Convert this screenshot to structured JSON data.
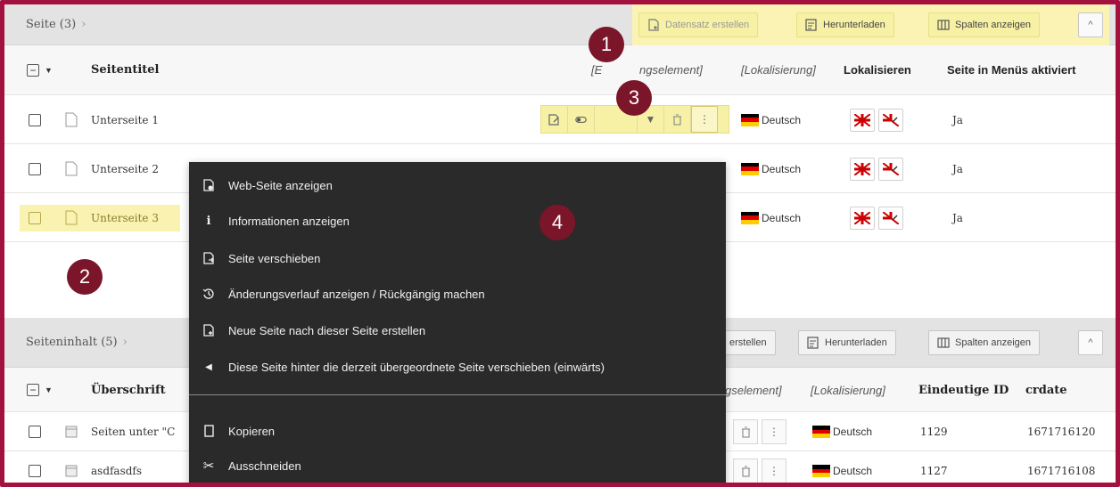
{
  "panel1": {
    "title": "Seite (3)",
    "chevron": "›",
    "buttons": {
      "create": "Datensatz erstellen",
      "download": "Herunterladen",
      "columns": "Spalten anzeigen"
    },
    "collapse": "^",
    "headers": {
      "title": "Seitentitel",
      "element": "[Bearbeitungselement]",
      "element_visible": "[E",
      "element_visible_2": "ngselement]",
      "localization": "[Lokalisierung]",
      "localize": "Lokalisieren",
      "menu_active": "Seite in Menüs aktiviert"
    },
    "rows": [
      {
        "title": "Unterseite 1",
        "language": "Deutsch",
        "menu": "Ja"
      },
      {
        "title": "Unterseite 2",
        "language": "Deutsch",
        "menu": "Ja"
      },
      {
        "title": "Unterseite 3",
        "language": "Deutsch",
        "menu": "Ja"
      }
    ]
  },
  "panel2": {
    "title": "Seiteninhalt (5)",
    "chevron": "›",
    "buttons": {
      "create_partial": "erstellen",
      "download": "Herunterladen",
      "columns": "Spalten anzeigen"
    },
    "collapse": "^",
    "headers": {
      "title": "Überschrift",
      "element_partial": "gselement]",
      "localization": "[Lokalisierung]",
      "uid": "Eindeutige ID",
      "crdate": "crdate"
    },
    "rows": [
      {
        "title": "Seiten unter \"C",
        "language": "Deutsch",
        "uid": "1129",
        "crdate": "1671716120"
      },
      {
        "title": "asdfasdfs",
        "language": "Deutsch",
        "uid": "1127",
        "crdate": "1671716108"
      }
    ]
  },
  "context_menu": {
    "items": [
      {
        "label": "Web-Seite anzeigen",
        "icon": "view-page-icon"
      },
      {
        "label": "Informationen anzeigen",
        "icon": "info-icon"
      },
      {
        "label": "Seite verschieben",
        "icon": "move-page-icon"
      },
      {
        "label": "Änderungsverlauf anzeigen / Rückgängig machen",
        "icon": "history-icon"
      },
      {
        "label": "Neue Seite nach dieser Seite erstellen",
        "icon": "new-page-icon"
      },
      {
        "label": "Diese Seite hinter die derzeit übergeordnete Seite verschieben (einwärts)",
        "icon": "arrow-left-icon"
      },
      {
        "label": "Kopieren",
        "icon": "copy-icon"
      },
      {
        "label": "Ausschneiden",
        "icon": "cut-icon"
      }
    ]
  },
  "badges": [
    "1",
    "2",
    "3",
    "4"
  ],
  "colors": {
    "frame": "#a3113e",
    "highlight": "#f7f1a6",
    "badge": "#7b1529",
    "menu_bg": "#2a2a2a"
  }
}
